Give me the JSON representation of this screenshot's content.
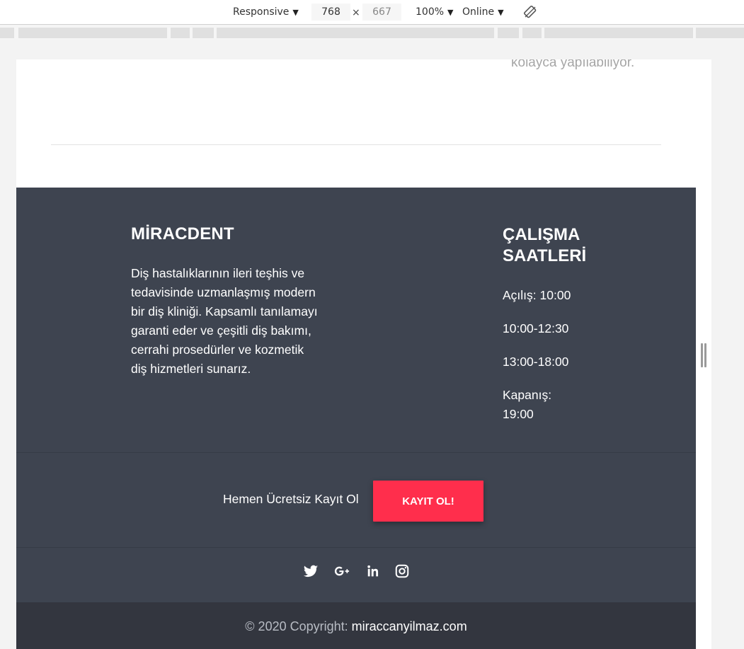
{
  "devtools": {
    "device": "Responsive",
    "width": "768",
    "height": "667",
    "zoom": "100%",
    "network": "Online",
    "dropdown_glyph": "▼",
    "times_glyph": "×"
  },
  "page": {
    "clipped_text": "kolayca yapılabiliyor.",
    "footer": {
      "brand": {
        "title": "MİRACDENT",
        "description": "Diş hastalıklarının ileri teşhis ve tedavisinde uzmanlaşmış modern bir diş kliniği. Kapsamlı tanılamayı garanti eder ve çeşitli diş bakımı, cerrahi prosedürler ve kozmetik diş hizmetleri sunarız."
      },
      "hours": {
        "title": "ÇALIŞMA SAATLERİ",
        "items": [
          "Açılış: 10:00",
          "10:00-12:30",
          "13:00-18:00",
          "Kapanış: 19:00"
        ]
      },
      "cta": {
        "text": "Hemen Ücretsiz Kayıt Ol",
        "button": "KAYIT OL!"
      },
      "social": [
        "twitter-icon",
        "google-plus-icon",
        "linkedin-icon",
        "instagram-icon"
      ],
      "copyright": {
        "prefix": "© 2020 Copyright: ",
        "site": "miraccanyilmaz.com"
      }
    }
  },
  "colors": {
    "footer_bg": "#3e4450",
    "bottom_bar_bg": "#33363f",
    "accent": "#ff2e4c"
  }
}
